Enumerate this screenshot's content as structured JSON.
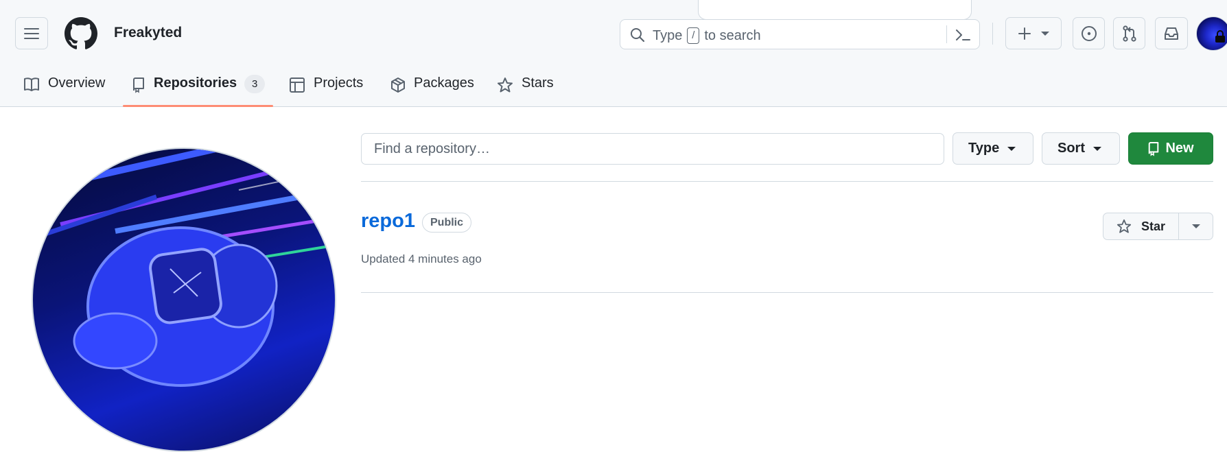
{
  "header": {
    "username": "Freakyted",
    "search": {
      "prefix": "Type",
      "shortcut": "/",
      "suffix": "to search"
    }
  },
  "tabs": [
    {
      "label": "Overview",
      "icon": "book-icon"
    },
    {
      "label": "Repositories",
      "icon": "repo-icon",
      "count": "3",
      "selected": true
    },
    {
      "label": "Projects",
      "icon": "table-icon"
    },
    {
      "label": "Packages",
      "icon": "package-icon"
    },
    {
      "label": "Stars",
      "icon": "star-icon"
    }
  ],
  "filters": {
    "find_placeholder": "Find a repository…",
    "type_label": "Type",
    "sort_label": "Sort",
    "new_label": "New"
  },
  "repos": [
    {
      "name": "repo1",
      "visibility": "Public",
      "updated": "Updated 4 minutes ago",
      "star_label": "Star"
    }
  ],
  "colors": {
    "accent_blue": "#0969da",
    "new_green": "#1f883d",
    "tab_underline": "#fd8c73"
  }
}
